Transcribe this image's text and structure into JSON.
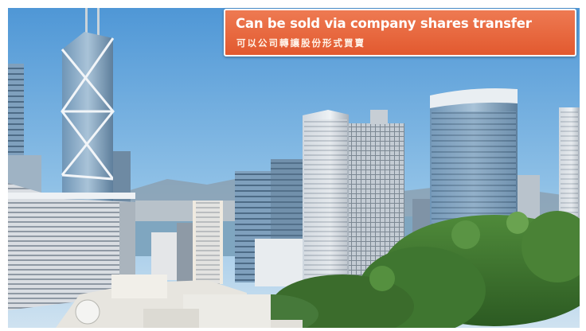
{
  "banner": {
    "title_en": "Can be sold via company shares transfer",
    "title_zh": "可以公司轉讓股份形式買賣",
    "background_color": "#e8643a",
    "border_color": "#ffffff"
  },
  "photo": {
    "subject": "city-skyline-photo"
  }
}
